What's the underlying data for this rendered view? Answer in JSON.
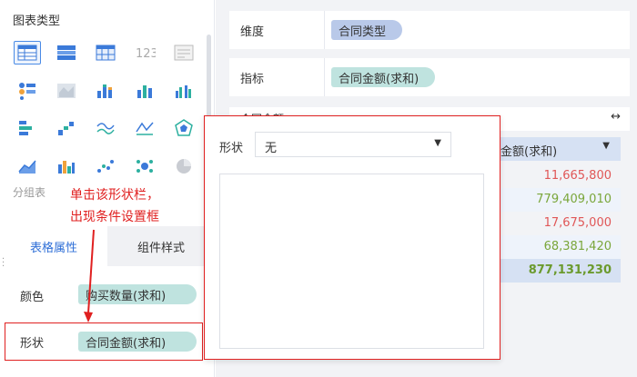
{
  "left_panel": {
    "chart_type_title": "图表类型",
    "group_table_label": "分组表",
    "annotation_line1": "单击该形状栏，",
    "annotation_line2": "出现条件设置框"
  },
  "tabs": {
    "table_props": "表格属性",
    "component_style": "组件样式"
  },
  "properties": {
    "color_label": "颜色",
    "color_field": "购买数量(求和)",
    "shape_label": "形状",
    "shape_field": "合同金额(求和)"
  },
  "fields": {
    "dimension_label": "维度",
    "dimension_value": "合同类型",
    "indicator_label": "指标",
    "indicator_value": "合同金额(求和)"
  },
  "preview": {
    "title": "合同金额",
    "column_header": "金额(求和)",
    "rows": [
      "11,665,800",
      "779,409,010",
      "17,675,000",
      "68,381,420"
    ],
    "total": "877,131,230"
  },
  "popup": {
    "shape_label": "形状",
    "select_value": "无"
  },
  "colors": {
    "accent": "#2f6fd7",
    "highlight": "#e02020",
    "green_pill": "#bfe3df",
    "blue_pill": "#b9c9e9"
  }
}
